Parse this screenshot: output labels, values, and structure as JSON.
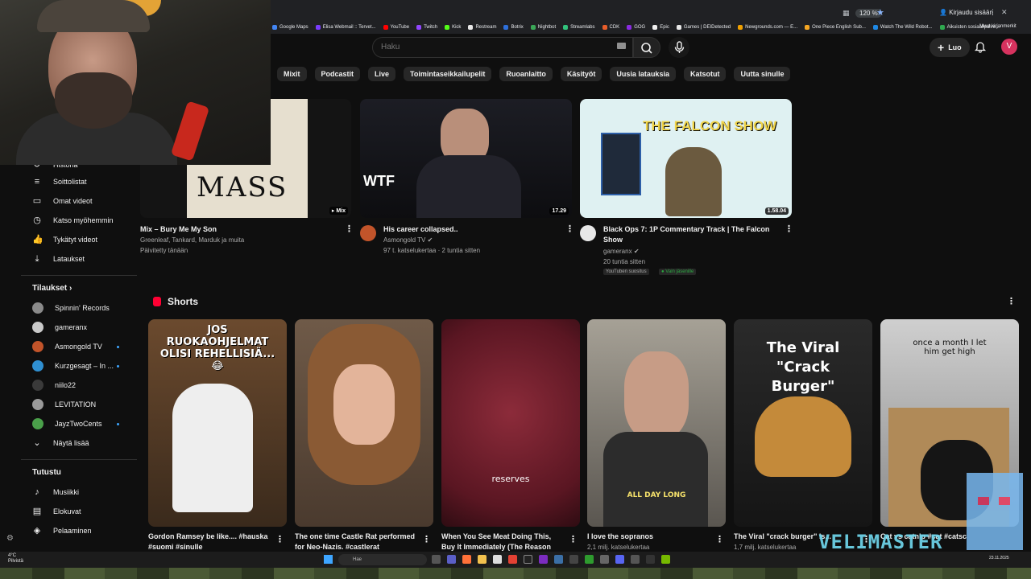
{
  "browser": {
    "zoom": "120 %",
    "signin": "Kirjaudu sisään",
    "bookmarks": [
      "Google Maps",
      "Elisa Webmail :: Tervet...",
      "YouTube",
      "Twitch",
      "Kick",
      "Restream",
      "Botrix",
      "Nightbot",
      "Streamlabs",
      "CDK",
      "GOG",
      "Epic",
      "Games | DEIDetected",
      "Newgrounds.com — E...",
      "One Piece English Sub...",
      "Watch The Wild Robot...",
      "Aikuisten sosiaalipalve..."
    ],
    "bookmarks_other": "Muut kirjanmerkit"
  },
  "header": {
    "search_placeholder": "Haku",
    "create_label": "Luo",
    "avatar_letter": "V"
  },
  "chips": [
    "Mixit",
    "Podcastit",
    "Live",
    "Toimintaseikkailupelit",
    "Ruoanlaitto",
    "Käsityöt",
    "Uusia latauksia",
    "Katsotut",
    "Uutta sinulle"
  ],
  "sidebar": {
    "you_items": [
      {
        "label": "Historia",
        "icon": "history-icon"
      },
      {
        "label": "Soittolistat",
        "icon": "playlist-icon"
      },
      {
        "label": "Omat videot",
        "icon": "video-icon"
      },
      {
        "label": "Katso myöhemmin",
        "icon": "clock-icon"
      },
      {
        "label": "Tykätyt videot",
        "icon": "like-icon"
      },
      {
        "label": "Lataukset",
        "icon": "download-icon"
      }
    ],
    "subs_heading": "Tilaukset",
    "subscriptions": [
      {
        "label": "Spinnin' Records",
        "color": "#8a8a8a"
      },
      {
        "label": "gameranx",
        "color": "#c9c9c9"
      },
      {
        "label": "Asmongold TV",
        "color": "#c2542a"
      },
      {
        "label": "Kurzgesagt – In ...",
        "color": "#2f8fd1"
      },
      {
        "label": "niilo22",
        "color": "#3a3a3a"
      },
      {
        "label": "LEVITATION",
        "color": "#9a9a9a"
      },
      {
        "label": "JayzTwoCents",
        "color": "#4aa04a"
      }
    ],
    "show_more": "Näytä lisää",
    "explore_heading": "Tutustu",
    "explore_items": [
      {
        "label": "Musiikki",
        "icon": "music-icon"
      },
      {
        "label": "Elokuvat",
        "icon": "film-icon"
      },
      {
        "label": "Pelaaminen",
        "icon": "gaming-icon"
      }
    ]
  },
  "videos": [
    {
      "title": "Mix – Bury Me My Son",
      "meta1": "Greenleaf, Tankard, Marduk ja muita",
      "meta2": "Päivitetty tänään",
      "duration": "Mix",
      "thumb_text": "MASS"
    },
    {
      "title": "His career collapsed..",
      "channel": "Asmongold TV",
      "meta2": "97 t. katselukertaa · 2 tuntia sitten",
      "duration": "17.29",
      "thumb_text": "WTF"
    },
    {
      "title": "Black Ops 7: 1P Commentary Track | The Falcon Show",
      "channel": "gameranx",
      "meta2": "20 tuntia sitten",
      "duration": "1.58.04",
      "thumb_text": "THE FALCON SHOW",
      "badge1": "YouTuben suositus",
      "badge2": "Vain jäsenille"
    }
  ],
  "shorts": {
    "heading": "Shorts",
    "items": [
      {
        "title": "Gordon Ramsey be like.... #hauska #suomi #sinulle",
        "caption": "JOS RUOKAOHJELMAT OLISI REHELLISIÄ...😂"
      },
      {
        "title": "The one time Castle Rat performed for Neo-Nazis. #castlerat",
        "caption": ""
      },
      {
        "title": "When You See Meat Doing This, Buy It Immediately (The Reason",
        "caption": "reserves"
      },
      {
        "title": "I love the sopranos",
        "meta": "2,1 milj. katselukertaa",
        "caption": "ALL DAY LONG"
      },
      {
        "title": "The Viral \"crack burger\" is...",
        "meta": "1,7 milj. katselukertaa",
        "caption": "The Viral \"Crack Burger\""
      },
      {
        "title": "Cat vs catnip #cat #catsc",
        "caption": "once a month I let him get high"
      }
    ]
  },
  "taskbar": {
    "temp": "4°C",
    "weather": "Pilvistä",
    "search": "Hae",
    "date": "23.11.2025"
  },
  "overlay": "VELIMASTER"
}
